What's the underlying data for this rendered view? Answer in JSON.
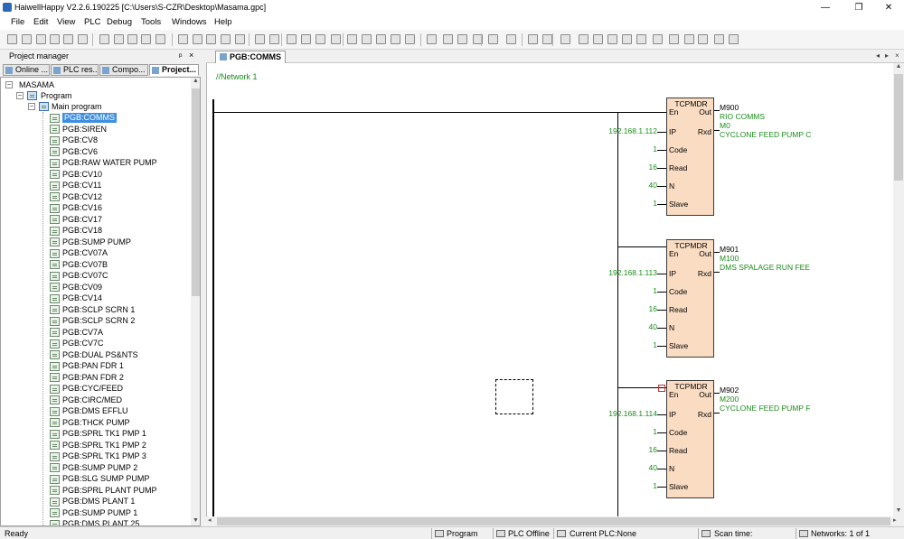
{
  "window": {
    "title": "HaiwellHappy V2.2.6.190225 [C:\\Users\\S-CZR\\Desktop\\Masama.gpc]",
    "minimize": "—",
    "restore": "❐",
    "close": "✕"
  },
  "menu": [
    "File",
    "Edit",
    "View",
    "PLC",
    "Debug",
    "Tools",
    "Windows",
    "Help"
  ],
  "project_manager": {
    "title": "Project manager",
    "pin": "ᵖ",
    "close": "×",
    "tabs": [
      "Online ...",
      "PLC res...",
      "Compo...",
      "Project..."
    ],
    "tree": {
      "root": "MASAMA",
      "program": "Program",
      "main_program": "Main program",
      "items": [
        "PGB:COMMS",
        "PGB:SIREN",
        "PGB:CV8",
        "PGB:CV6",
        "PGB:RAW WATER PUMP",
        "PGB:CV10",
        "PGB:CV11",
        "PGB:CV12",
        "PGB:CV16",
        "PGB:CV17",
        "PGB:CV18",
        "PGB:SUMP PUMP",
        "PGB:CV07A",
        "PGB:CV07B",
        "PGB:CV07C",
        "PGB:CV09",
        "PGB:CV14",
        "PGB:SCLP SCRN 1",
        "PGB:SCLP SCRN 2",
        "PGB:CV7A",
        "PGB:CV7C",
        "PGB:DUAL PS&NTS",
        "PGB:PAN FDR 1",
        "PGB:PAN FDR 2",
        "PGB:CYC/FEED",
        "PGB:CIRC/MED",
        "PGB:DMS EFFLU",
        "PGB:THCK PUMP",
        "PGB:SPRL TK1 PMP 1",
        "PGB:SPRL TK1 PMP 2",
        "PGB:SPRL TK1 PMP 3",
        "PGB:SUMP PUMP 2",
        "PGB:SLG SUMP PUMP",
        "PGB:SPRL PLANT PUMP",
        "PGB:DMS PLANT 1",
        "PGB:SUMP PUMP 1",
        "PGB:DMS PLANT 25"
      ],
      "selected_index": 0
    }
  },
  "editor": {
    "tab": "PGB:COMMS",
    "nav_left": "◂",
    "nav_right": "▸",
    "nav_close": "×",
    "network_label": "//Network 1",
    "blocks": [
      {
        "name": "TCPMDR",
        "pins_left": [
          "En",
          "IP",
          "Code",
          "Read",
          "N",
          "Slave"
        ],
        "pins_right": [
          "Out",
          "Rxd"
        ],
        "inputs": [
          "192.168.1.112",
          "1",
          "16",
          "40",
          "1"
        ],
        "out": "M900",
        "rxd_lines": [
          "RIO COMMS",
          "M0",
          "CYCLONE FEED PUMP C"
        ]
      },
      {
        "name": "TCPMDR",
        "pins_left": [
          "En",
          "IP",
          "Code",
          "Read",
          "N",
          "Slave"
        ],
        "pins_right": [
          "Out",
          "Rxd"
        ],
        "inputs": [
          "192.168.1.113",
          "1",
          "16",
          "40",
          "1"
        ],
        "out": "M901",
        "rxd_lines": [
          "M100",
          "DMS SPALAGE RUN FEE"
        ]
      },
      {
        "name": "TCPMDR",
        "pins_left": [
          "En",
          "IP",
          "Code",
          "Read",
          "N",
          "Slave"
        ],
        "pins_right": [
          "Out",
          "Rxd"
        ],
        "inputs": [
          "192.168.1.114",
          "1",
          "16",
          "40",
          "1"
        ],
        "out": "M902",
        "rxd_lines": [
          "M200",
          "CYCLONE FEED PUMP F"
        ]
      }
    ]
  },
  "status_bar": {
    "ready": "Ready",
    "program": "Program",
    "plc_state": "PLC Offline",
    "current_plc": "Current PLC:None",
    "scan_time": "Scan time:",
    "networks": "Networks:  1 of 1"
  }
}
